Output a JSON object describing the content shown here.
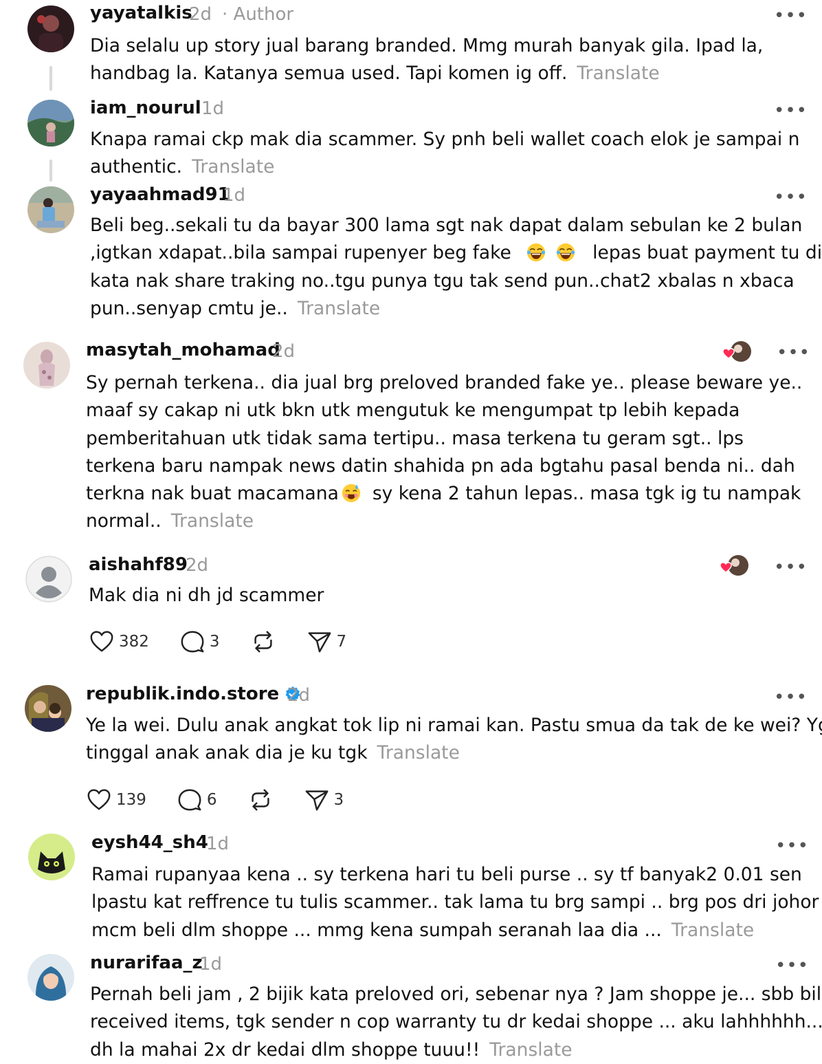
{
  "comments": [
    {
      "username": "yayatalkis",
      "time": "2d",
      "author_label": "· Author",
      "lines": [
        "Dia selalu up story jual barang branded. Mmg murah banyak gila. Ipad la,",
        "handbag la. Katanya semua used. Tapi komen ig off."
      ],
      "translate": "Translate"
    },
    {
      "username": "iam_nourul",
      "time": "1d",
      "lines": [
        "Knapa ramai ckp mak dia scammer. Sy pnh beli wallet coach elok je sampai n",
        "authentic."
      ],
      "translate": "Translate"
    },
    {
      "username": "yayaahmad91",
      "time": "1d",
      "lines": [
        "Beli beg..sekali tu da bayar 300 lama sgt nak dapat dalam sebulan ke 2 bulan",
        ",igtkan xdapat..bila sampai rupenyer beg fake",
        "lepas buat payment tu dia",
        "kata nak share traking no..tgu punya tgu tak send pun..chat2 xbalas n xbaca",
        "pun..senyap cmtu je.."
      ],
      "translate": "Translate"
    },
    {
      "username": "masytah_mohamad",
      "time": "2d",
      "lines": [
        "Sy pernah terkena.. dia jual brg preloved branded fake ye.. please beware ye..",
        "maaf sy cakap ni utk bkn utk mengutuk ke mengumpat tp lebih kepada",
        "pemberitahuan utk tidak sama tertipu.. masa terkena tu geram sgt.. lps",
        "terkena baru nampak news datin shahida pn ada bgtahu pasal benda ni.. dah",
        "terkna nak buat macamana",
        "sy kena 2 tahun lepas.. masa tgk ig tu nampak",
        "normal.."
      ],
      "translate": "Translate"
    },
    {
      "username": "aishahf89",
      "time": "2d",
      "lines": [
        "Mak dia ni dh jd scammer"
      ],
      "actions": {
        "likes": "382",
        "replies": "3",
        "shares": "7"
      }
    },
    {
      "username": "republik.indo.store",
      "time": "2d",
      "lines": [
        "Ye la wei. Dulu anak angkat tok lip ni ramai kan. Pastu smua da tak de ke wei? Yg",
        "tinggal anak anak dia je ku tgk"
      ],
      "translate": "Translate",
      "actions": {
        "likes": "139",
        "replies": "6",
        "shares": "3"
      }
    },
    {
      "username": "eysh44_sh4",
      "time": "1d",
      "lines": [
        "Ramai rupanyaa kena .. sy terkena hari tu beli purse .. sy tf banyak2 0.01 sen",
        "lpastu kat reffrence tu tulis scammer.. tak lama tu brg sampi .. brg pos dri johor tp",
        "mcm beli dlm shoppe ... mmg kena sumpah seranah laa dia ..."
      ],
      "translate": "Translate"
    },
    {
      "username": "nurarifaa_z",
      "time": "1d",
      "lines": [
        "Pernah beli jam , 2 bijik kata preloved ori, sebenar nya ? Jam shoppe je... sbb bila",
        "received items, tgk sender n cop warranty tu dr kedai shoppe ... aku lahhhhhh...",
        "dh la mahai 2x dr kedai dlm shoppe tuuu!!"
      ],
      "translate": "Translate"
    }
  ],
  "more_glyph": "•••",
  "colors": {
    "text": "#111111",
    "muted": "#9a9a9a",
    "verified": "#1d9bf0",
    "heart": "#ff2a55"
  },
  "icons": [
    "heart-icon",
    "comment-icon",
    "repost-icon",
    "share-icon",
    "verified-badge-icon",
    "laughing-emoji",
    "smiling-sweat-emoji"
  ]
}
